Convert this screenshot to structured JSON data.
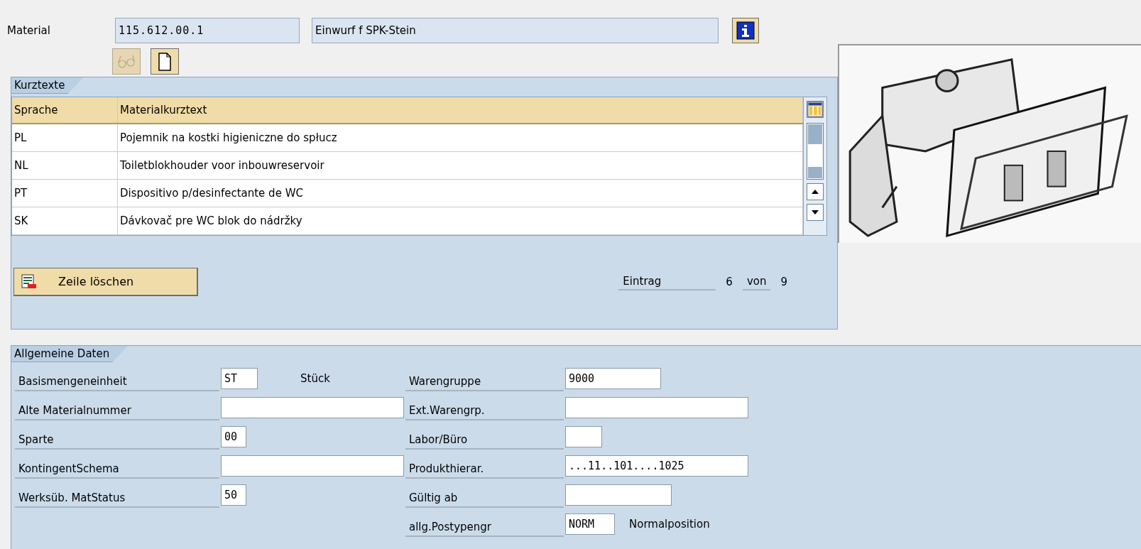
{
  "header": {
    "material_label": "Material",
    "material_number": "115.612.00.1",
    "material_description": "Einwurf f SPK-Stein"
  },
  "toolbar": [
    {
      "kind": "glasses",
      "disabled": true
    },
    {
      "kind": "document",
      "disabled": false
    }
  ],
  "short_texts": {
    "title": "Kurztexte",
    "columns": [
      "Sprache",
      "Materialkurztext"
    ],
    "rows": [
      {
        "language": "PL",
        "text": "Pojemnik na kostki higieniczne do spłucz"
      },
      {
        "language": "NL",
        "text": "Toiletblokhouder voor inbouwreservoir"
      },
      {
        "language": "PT",
        "text": "Dispositivo p/desinfectante de WC"
      },
      {
        "language": "SK",
        "text": "Dávkovač pre WC blok do nádržky"
      }
    ],
    "delete_button": "Zeile löschen",
    "entry_label": "Eintrag",
    "entry_current": "6",
    "entry_of_label": "von",
    "entry_total": "9"
  },
  "general_data": {
    "title": "Allgemeine Daten",
    "left_fields": [
      {
        "label": "Basismengeneinheit",
        "value": "ST",
        "text": "Stück"
      },
      {
        "label": "Alte Materialnummer"
      },
      {
        "label": "Sparte",
        "value": "00"
      },
      {
        "label": "KontingentSchema"
      },
      {
        "label": "Werksüb. MatStatus",
        "value": "50"
      }
    ],
    "right_fields": [
      {
        "label": "Warengruppe",
        "value": "9000"
      },
      {
        "label": "Ext.Warengrp."
      },
      {
        "label": "Labor/Büro"
      },
      {
        "label": "Produkthierar.",
        "value": "...11..101....1025"
      },
      {
        "label": "Gültig ab"
      },
      {
        "label": "allg.Postypengr",
        "value": "NORM",
        "text": "Normalposition"
      }
    ]
  }
}
